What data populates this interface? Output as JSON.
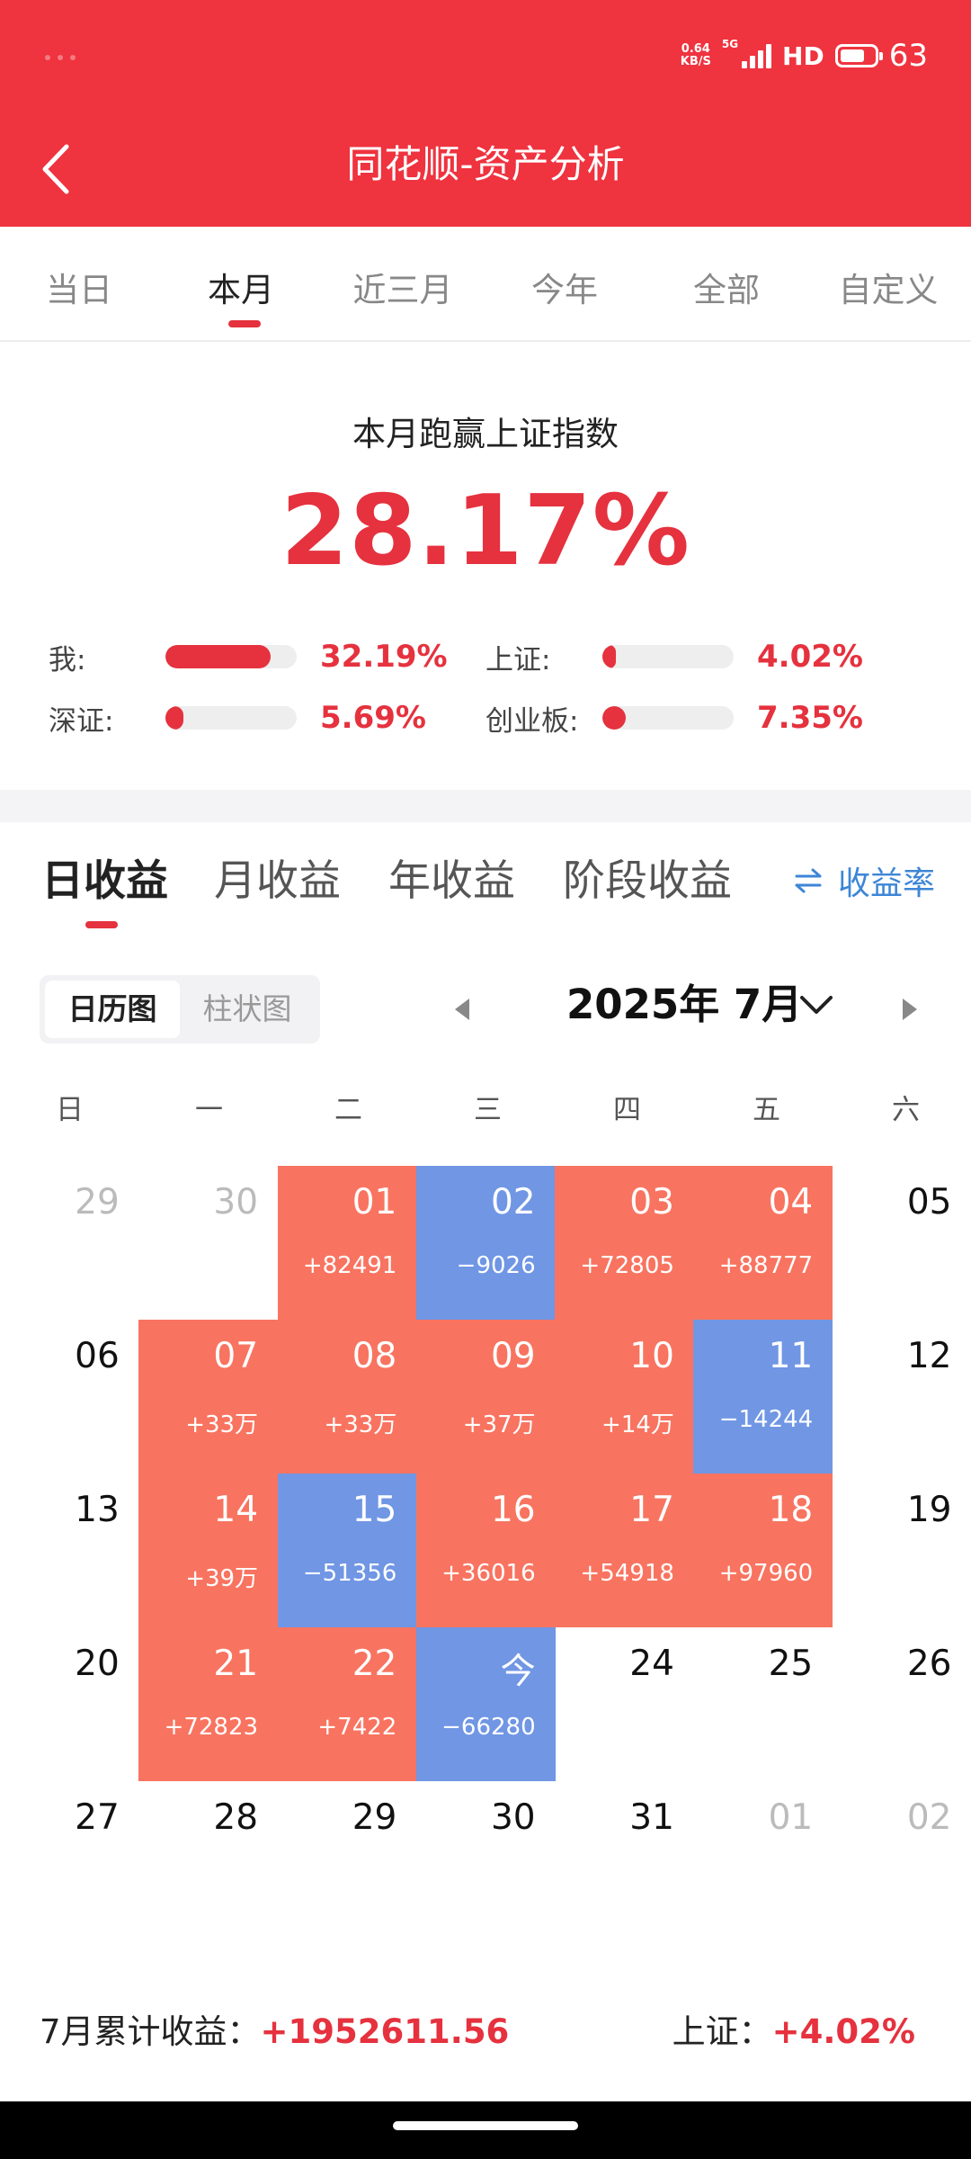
{
  "status_bar": {
    "net_speed_value": "0.64",
    "net_speed_unit": "KB/S",
    "network": "5G",
    "hd": "HD",
    "battery": "63"
  },
  "header": {
    "title": "同花顺-资产分析"
  },
  "period_tabs": [
    "当日",
    "本月",
    "近三月",
    "今年",
    "全部",
    "自定义"
  ],
  "period_active": "本月",
  "comparison": {
    "title": "本月跑赢上证指数",
    "value": "28.17%",
    "rows": [
      {
        "label": "我:",
        "pct": "32.19%",
        "level": 0.8
      },
      {
        "label": "上证:",
        "pct": "4.02%",
        "level": 0.1
      },
      {
        "label": "深证:",
        "pct": "5.69%",
        "level": 0.14
      },
      {
        "label": "创业板:",
        "pct": "7.35%",
        "level": 0.18
      }
    ]
  },
  "income_tabs": [
    "日收益",
    "月收益",
    "年收益",
    "阶段收益"
  ],
  "income_active": "日收益",
  "rate_toggle": {
    "icon": "swap-arrows-icon",
    "label": "收益率"
  },
  "view_switch": [
    "日历图",
    "柱状图"
  ],
  "month": "2025年 7月",
  "weekdays": [
    "日",
    "一",
    "二",
    "三",
    "四",
    "五",
    "六"
  ],
  "calendar": [
    [
      {
        "d": "29",
        "muted": true
      },
      {
        "d": "30",
        "muted": true
      },
      {
        "d": "01",
        "amt": "+82491",
        "type": "gain"
      },
      {
        "d": "02",
        "amt": "−9026",
        "type": "loss"
      },
      {
        "d": "03",
        "amt": "+72805",
        "type": "gain"
      },
      {
        "d": "04",
        "amt": "+88777",
        "type": "gain"
      },
      {
        "d": "05"
      }
    ],
    [
      {
        "d": "06"
      },
      {
        "d": "07",
        "amt": "+33万",
        "type": "gain"
      },
      {
        "d": "08",
        "amt": "+33万",
        "type": "gain"
      },
      {
        "d": "09",
        "amt": "+37万",
        "type": "gain"
      },
      {
        "d": "10",
        "amt": "+14万",
        "type": "gain"
      },
      {
        "d": "11",
        "amt": "−14244",
        "type": "loss"
      },
      {
        "d": "12"
      }
    ],
    [
      {
        "d": "13"
      },
      {
        "d": "14",
        "amt": "+39万",
        "type": "gain"
      },
      {
        "d": "15",
        "amt": "−51356",
        "type": "loss"
      },
      {
        "d": "16",
        "amt": "+36016",
        "type": "gain"
      },
      {
        "d": "17",
        "amt": "+54918",
        "type": "gain"
      },
      {
        "d": "18",
        "amt": "+97960",
        "type": "gain"
      },
      {
        "d": "19"
      }
    ],
    [
      {
        "d": "20"
      },
      {
        "d": "21",
        "amt": "+72823",
        "type": "gain"
      },
      {
        "d": "22",
        "amt": "+7422",
        "type": "gain"
      },
      {
        "d": "今",
        "amt": "−66280",
        "type": "loss"
      },
      {
        "d": "24"
      },
      {
        "d": "25"
      },
      {
        "d": "26"
      }
    ],
    [
      {
        "d": "27"
      },
      {
        "d": "28"
      },
      {
        "d": "29"
      },
      {
        "d": "30"
      },
      {
        "d": "31"
      },
      {
        "d": "01",
        "muted": true
      },
      {
        "d": "02",
        "muted": true
      }
    ]
  ],
  "footer": {
    "left_label": "7月累计收益：",
    "left_value": "+1952611.56",
    "right_label": "上证：",
    "right_value": "+4.02%"
  },
  "colors": {
    "header": "#ef333f",
    "accent": "#e5323e",
    "gain": "#f87460",
    "loss": "#7096e4",
    "link": "#3d86d6"
  }
}
